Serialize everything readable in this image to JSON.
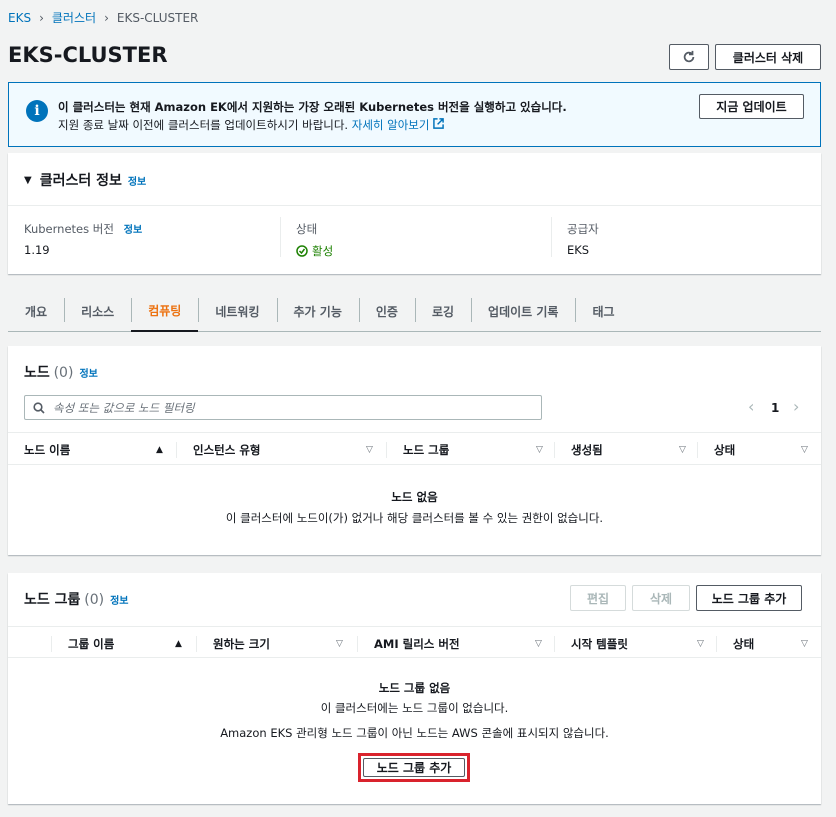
{
  "breadcrumb": {
    "items": [
      "EKS",
      "클러스터",
      "EKS-CLUSTER"
    ]
  },
  "page": {
    "title": "EKS-CLUSTER",
    "delete_label": "클러스터 삭제"
  },
  "alert": {
    "title": "이 클러스터는 현재 Amazon EK에서 지원하는 가장 오래된 Kubernetes 버전을 실행하고 있습니다.",
    "body": "지원 종료 날짜 이전에 클러스터를 업데이트하시기 바랍니다.",
    "link": "자세히 알아보기",
    "update_label": "지금 업데이트"
  },
  "cluster_info": {
    "title": "클러스터 정보",
    "info": "정보",
    "k8s_label": "Kubernetes 버전",
    "k8s_value": "1.19",
    "status_label": "상태",
    "status_value": "활성",
    "provider_label": "공급자",
    "provider_value": "EKS"
  },
  "tabs": [
    "개요",
    "리소스",
    "컴퓨팅",
    "네트워킹",
    "추가 기능",
    "인증",
    "로깅",
    "업데이트 기록",
    "태그"
  ],
  "nodes": {
    "title": "노드",
    "count": "(0)",
    "info": "정보",
    "search_placeholder": "속성 또는 값으로 노드 필터링",
    "page": "1",
    "columns": [
      "노드 이름",
      "인스턴스 유형",
      "노드 그룹",
      "생성됨",
      "상태"
    ],
    "empty_title": "노드 없음",
    "empty_body": "이 클러스터에 노드이(가) 없거나 해당 클러스터를 볼 수 있는 권한이 없습니다."
  },
  "node_groups": {
    "title": "노드 그룹",
    "count": "(0)",
    "info": "정보",
    "edit_label": "편집",
    "delete_label": "삭제",
    "add_label": "노드 그룹 추가",
    "columns": [
      "그룹 이름",
      "원하는 크기",
      "AMI 릴리스 버전",
      "시작 템플릿",
      "상태"
    ],
    "empty_title": "노드 그룹 없음",
    "empty_body1": "이 클러스터에는 노드 그룹이 없습니다.",
    "empty_body2": "Amazon EKS 관리형 노드 그룹이 아닌 노드는 AWS 콘솔에 표시되지 않습니다.",
    "empty_add_label": "노드 그룹 추가"
  },
  "colors": {
    "accent": "#0073bb",
    "active_tab": "#ec7211",
    "highlight": "#d9232d",
    "success": "#1d8102"
  }
}
